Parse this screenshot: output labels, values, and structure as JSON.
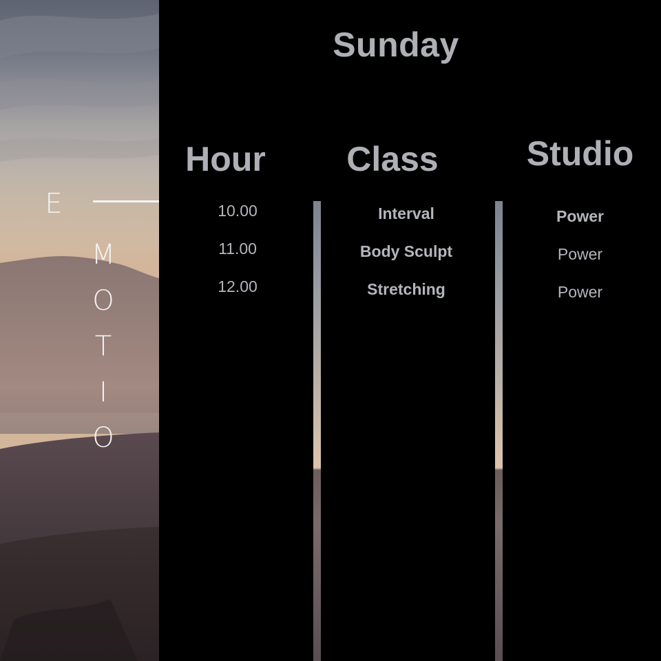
{
  "brand_letters": [
    "E",
    "M",
    "O",
    "T",
    "I",
    "O"
  ],
  "schedule": {
    "day": "Sunday",
    "headers": {
      "hour": "Hour",
      "class": "Class",
      "studio": "Studio"
    },
    "rows": [
      {
        "hour": "10.00",
        "class": "Interval",
        "studio": "Power"
      },
      {
        "hour": "11.00",
        "class": "Body Sculpt",
        "studio": "Power"
      },
      {
        "hour": "12.00",
        "class": "Stretching",
        "studio": "Power"
      }
    ]
  },
  "colors": {
    "background": "#000000",
    "text": "#aeb0b6",
    "brand_text": "#f2f2f2"
  }
}
